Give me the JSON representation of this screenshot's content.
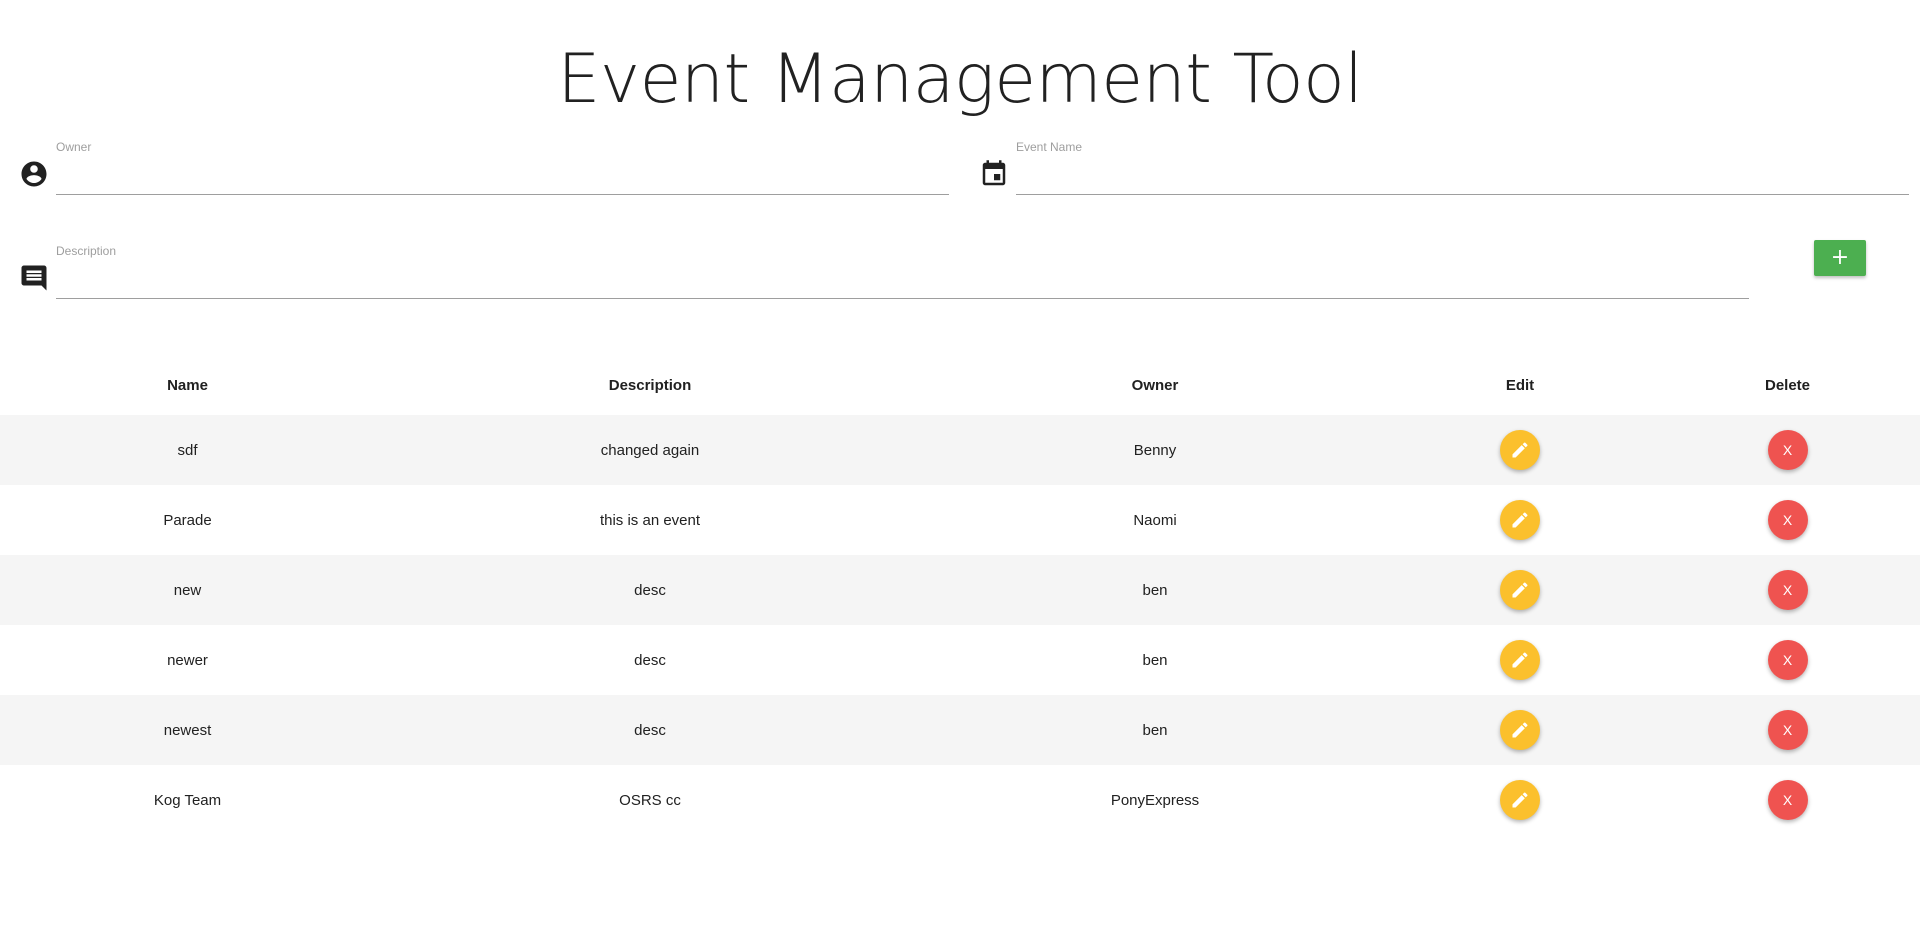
{
  "app": {
    "title": "Event Management Tool"
  },
  "form": {
    "owner": {
      "label": "Owner",
      "value": "",
      "icon": "account-circle-icon"
    },
    "event_name": {
      "label": "Event Name",
      "value": "",
      "icon": "calendar-icon"
    },
    "description": {
      "label": "Description",
      "value": "",
      "icon": "comment-icon"
    },
    "add_label": "+"
  },
  "table": {
    "headers": [
      "Name",
      "Description",
      "Owner",
      "Edit",
      "Delete"
    ],
    "delete_label": "X",
    "rows": [
      {
        "name": "sdf",
        "description": "changed again",
        "owner": "Benny"
      },
      {
        "name": "Parade",
        "description": "this is an event",
        "owner": "Naomi"
      },
      {
        "name": "new",
        "description": "desc",
        "owner": "ben"
      },
      {
        "name": "newer",
        "description": "desc",
        "owner": "ben"
      },
      {
        "name": "newest",
        "description": "desc",
        "owner": "ben"
      },
      {
        "name": "Kog Team",
        "description": "OSRS cc",
        "owner": "PonyExpress"
      }
    ]
  },
  "colors": {
    "add": "#4caf50",
    "edit": "#fbc02d",
    "delete": "#ef5350",
    "stripe": "#f5f5f5"
  }
}
